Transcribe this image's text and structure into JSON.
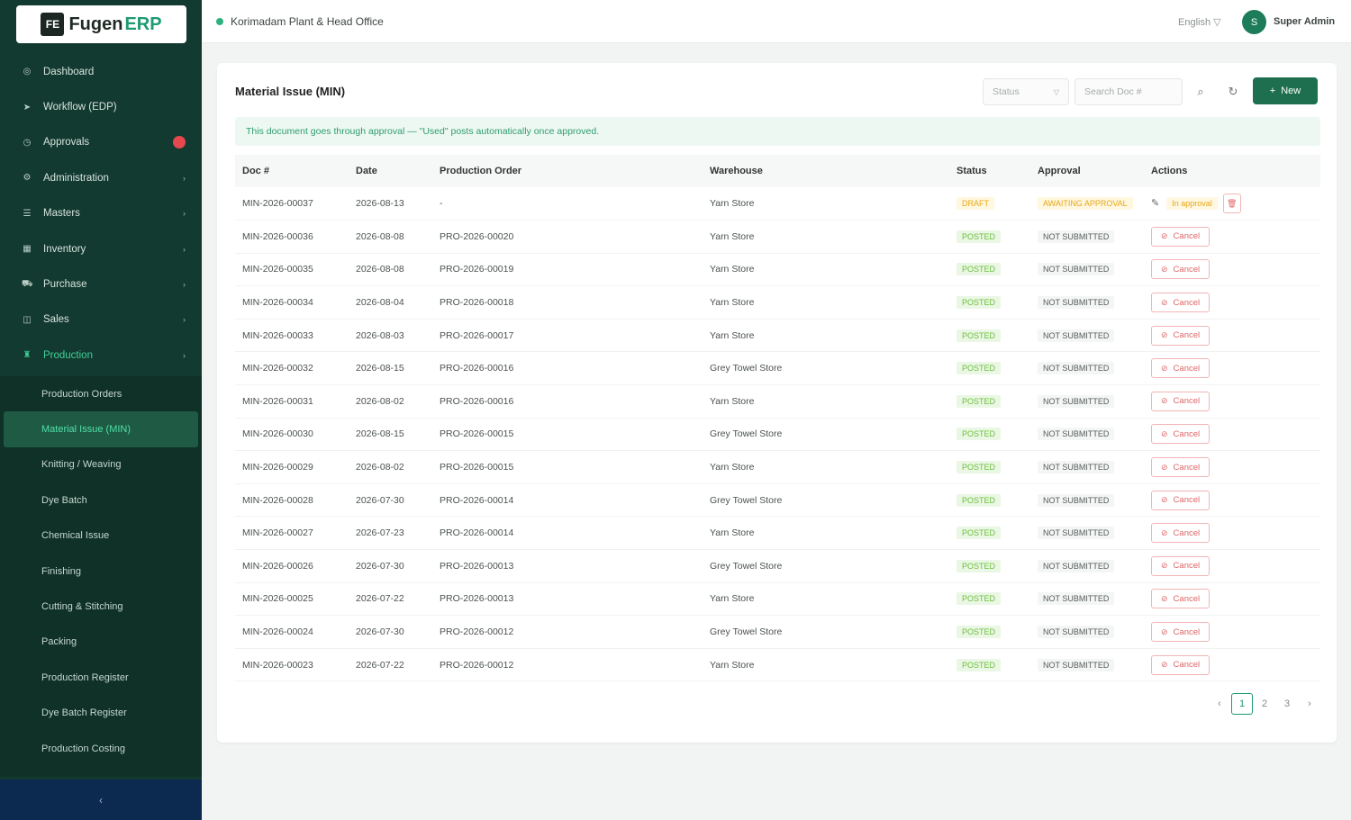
{
  "app": {
    "logo_text": "Fugen",
    "logo_accent": "ERP",
    "accent_color": "#1d6f50"
  },
  "sidebar": {
    "items": [
      {
        "label": "Dashboard",
        "icon": "dashboard-icon",
        "glyph": "◎"
      },
      {
        "label": "Workflow (EDP)",
        "icon": "workflow-icon",
        "glyph": "➤"
      },
      {
        "label": "Approvals",
        "icon": "approvals-icon",
        "glyph": "◷",
        "badge": true
      },
      {
        "label": "Administration",
        "icon": "admin-icon",
        "glyph": "⚙",
        "chevron": true
      },
      {
        "label": "Masters",
        "icon": "masters-icon",
        "glyph": "☰",
        "chevron": true
      },
      {
        "label": "Inventory",
        "icon": "inventory-icon",
        "glyph": "▦",
        "chevron": true
      },
      {
        "label": "Purchase",
        "icon": "purchase-icon",
        "glyph": "⛟",
        "chevron": true
      },
      {
        "label": "Sales",
        "icon": "sales-icon",
        "glyph": "◫",
        "chevron": true
      },
      {
        "label": "Production",
        "icon": "production-icon",
        "glyph": "♜",
        "chevron": true,
        "active": true
      }
    ],
    "submenu": [
      "Production Orders",
      "Material Issue (MIN)",
      "Knitting / Weaving",
      "Dye Batch",
      "Chemical Issue",
      "Finishing",
      "Cutting & Stitching",
      "Packing",
      "Production Register",
      "Dye Batch Register",
      "Production Costing"
    ],
    "active_submenu_index": 1,
    "collapse_label": "‹"
  },
  "topbar": {
    "branch": "Korimadam Plant & Head Office",
    "language": "English ▽",
    "avatar_initial": "S",
    "user_name": "Super Admin"
  },
  "page": {
    "title": "Material Issue (MIN)",
    "status_filter": "Status",
    "search_placeholder": "Search Doc #",
    "new_label": "New",
    "notice": "This document goes through approval — \"Used\" posts automatically once approved."
  },
  "table": {
    "columns": [
      "Doc #",
      "Date",
      "Production Order",
      "Warehouse",
      "Status",
      "Approval",
      "Actions"
    ],
    "rows": [
      {
        "doc": "MIN-2026-00037",
        "date": "2026-08-13",
        "po": "-",
        "wh": "Yarn Store",
        "status": "DRAFT",
        "approval": "AWAITING APPROVAL",
        "action": "draft"
      },
      {
        "doc": "MIN-2026-00036",
        "date": "2026-08-08",
        "po": "PRO-2026-00020",
        "wh": "Yarn Store",
        "status": "POSTED",
        "approval": "NOT SUBMITTED",
        "action": "cancel"
      },
      {
        "doc": "MIN-2026-00035",
        "date": "2026-08-08",
        "po": "PRO-2026-00019",
        "wh": "Yarn Store",
        "status": "POSTED",
        "approval": "NOT SUBMITTED",
        "action": "cancel"
      },
      {
        "doc": "MIN-2026-00034",
        "date": "2026-08-04",
        "po": "PRO-2026-00018",
        "wh": "Yarn Store",
        "status": "POSTED",
        "approval": "NOT SUBMITTED",
        "action": "cancel"
      },
      {
        "doc": "MIN-2026-00033",
        "date": "2026-08-03",
        "po": "PRO-2026-00017",
        "wh": "Yarn Store",
        "status": "POSTED",
        "approval": "NOT SUBMITTED",
        "action": "cancel"
      },
      {
        "doc": "MIN-2026-00032",
        "date": "2026-08-15",
        "po": "PRO-2026-00016",
        "wh": "Grey Towel Store",
        "status": "POSTED",
        "approval": "NOT SUBMITTED",
        "action": "cancel"
      },
      {
        "doc": "MIN-2026-00031",
        "date": "2026-08-02",
        "po": "PRO-2026-00016",
        "wh": "Yarn Store",
        "status": "POSTED",
        "approval": "NOT SUBMITTED",
        "action": "cancel"
      },
      {
        "doc": "MIN-2026-00030",
        "date": "2026-08-15",
        "po": "PRO-2026-00015",
        "wh": "Grey Towel Store",
        "status": "POSTED",
        "approval": "NOT SUBMITTED",
        "action": "cancel"
      },
      {
        "doc": "MIN-2026-00029",
        "date": "2026-08-02",
        "po": "PRO-2026-00015",
        "wh": "Yarn Store",
        "status": "POSTED",
        "approval": "NOT SUBMITTED",
        "action": "cancel"
      },
      {
        "doc": "MIN-2026-00028",
        "date": "2026-07-30",
        "po": "PRO-2026-00014",
        "wh": "Grey Towel Store",
        "status": "POSTED",
        "approval": "NOT SUBMITTED",
        "action": "cancel"
      },
      {
        "doc": "MIN-2026-00027",
        "date": "2026-07-23",
        "po": "PRO-2026-00014",
        "wh": "Yarn Store",
        "status": "POSTED",
        "approval": "NOT SUBMITTED",
        "action": "cancel"
      },
      {
        "doc": "MIN-2026-00026",
        "date": "2026-07-30",
        "po": "PRO-2026-00013",
        "wh": "Grey Towel Store",
        "status": "POSTED",
        "approval": "NOT SUBMITTED",
        "action": "cancel"
      },
      {
        "doc": "MIN-2026-00025",
        "date": "2026-07-22",
        "po": "PRO-2026-00013",
        "wh": "Yarn Store",
        "status": "POSTED",
        "approval": "NOT SUBMITTED",
        "action": "cancel"
      },
      {
        "doc": "MIN-2026-00024",
        "date": "2026-07-30",
        "po": "PRO-2026-00012",
        "wh": "Grey Towel Store",
        "status": "POSTED",
        "approval": "NOT SUBMITTED",
        "action": "cancel"
      },
      {
        "doc": "MIN-2026-00023",
        "date": "2026-07-22",
        "po": "PRO-2026-00012",
        "wh": "Yarn Store",
        "status": "POSTED",
        "approval": "NOT SUBMITTED",
        "action": "cancel"
      }
    ],
    "cancel_label": "Cancel",
    "draft_action_label": "In approval"
  },
  "pagination": {
    "prev": "‹",
    "pages": [
      "1",
      "2",
      "3"
    ],
    "current": "1",
    "next": "›"
  }
}
